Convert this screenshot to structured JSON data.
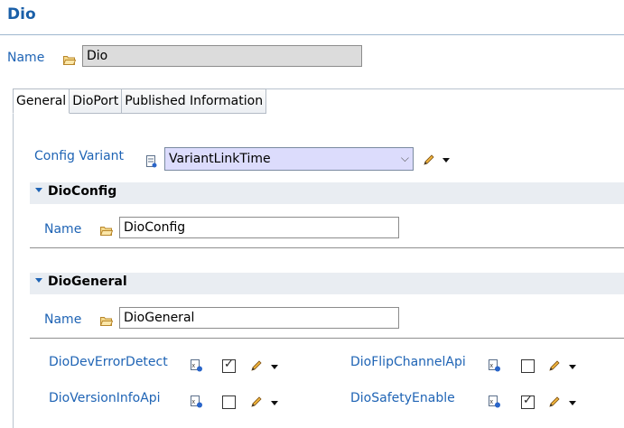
{
  "page_title": "Dio",
  "name_field": {
    "label": "Name",
    "value": "Dio"
  },
  "tabs": [
    {
      "label": "General"
    },
    {
      "label": "DioPort"
    },
    {
      "label": "Published Information"
    }
  ],
  "config_variant": {
    "label": "Config Variant",
    "value": "VariantLinkTime"
  },
  "sections": [
    {
      "title": "DioConfig",
      "name_label": "Name",
      "name_value": "DioConfig"
    },
    {
      "title": "DioGeneral",
      "name_label": "Name",
      "name_value": "DioGeneral"
    }
  ],
  "params": [
    {
      "label": "DioDevErrorDetect",
      "checked": true
    },
    {
      "label": "DioFlipChannelApi",
      "checked": false
    },
    {
      "label": "DioVersionInfoApi",
      "checked": false
    },
    {
      "label": "DioSafetyEnable",
      "checked": true
    }
  ],
  "colors": {
    "label_blue": "#1f64b5",
    "title_blue": "#1a5fa8",
    "variant_bg": "#dcdcfc",
    "section_bg": "#e9edf2"
  }
}
